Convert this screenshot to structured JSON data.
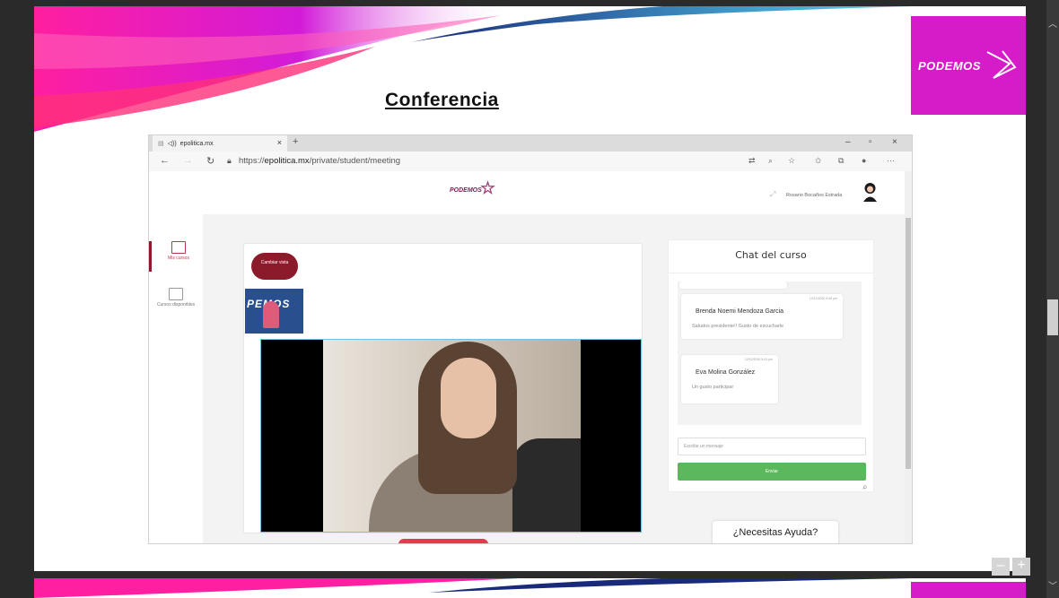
{
  "slide": {
    "title": "Conferencia",
    "logo_text": "PODEMOS"
  },
  "browser": {
    "tab_label": "epolitica.mx",
    "tab_sound": "◁))",
    "tab_close": "×",
    "new_tab": "+",
    "win_min": "–",
    "win_max": "▫",
    "win_close": "×",
    "back": "←",
    "forward": "→",
    "refresh": "↻",
    "url_prefix": "https://",
    "url_domain": "epolitica.mx",
    "url_path": "/private/student/meeting",
    "toolbar_icons": [
      "translate-icon",
      "zoom-icon",
      "star-icon",
      "favorites-icon",
      "collections-icon",
      "profile-icon",
      "more-icon"
    ]
  },
  "app": {
    "logo": "PODEMOS",
    "user_name": "Rosario Bocaños Estrada",
    "expand": "⤢",
    "sidebar": [
      {
        "label": "Mis cursos",
        "active": true
      },
      {
        "label": "Cursos disponibles",
        "active": false
      }
    ],
    "cambiar_vista": "Cambiar vista",
    "thumb_text": "PEMOS"
  },
  "chat": {
    "title": "Chat del curso",
    "messages": [
      {
        "time": "12/12/2020 5:40 pm",
        "name": "Brenda Noemi Mendoza Garcia",
        "body": "Saludos presidente!! Gusto de escucharle"
      },
      {
        "time": "12/12/2020 5:41 pm",
        "name": "Eva Molina González",
        "body": "Un gusto participar"
      }
    ],
    "input_placeholder": "Escribe un mensaje",
    "send_label": "Enviar"
  },
  "help": {
    "label": "¿Necesitas Ayuda?"
  },
  "viewer": {
    "zoom_out": "–",
    "zoom_in": "+"
  },
  "colors": {
    "brand_magenta": "#d61cc9",
    "brand_maroon": "#8b1a2a",
    "send_green": "#5cb85c"
  }
}
